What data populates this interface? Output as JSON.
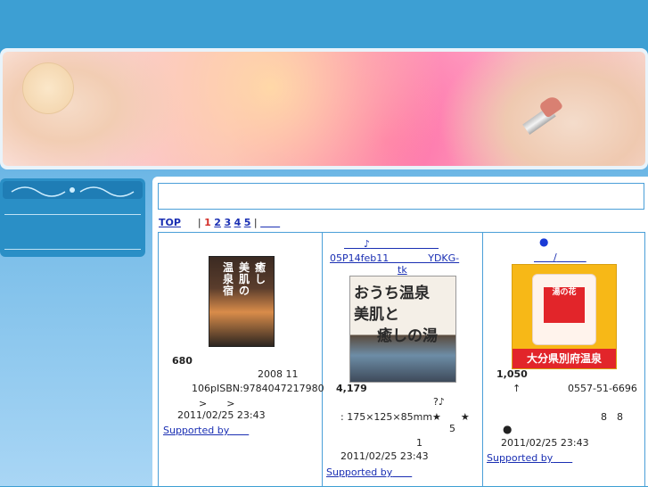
{
  "pager": {
    "top_label": "TOP",
    "sep": "|",
    "current": "1",
    "pages": [
      "2",
      "3",
      "4",
      "5"
    ],
    "end_link": "　　"
  },
  "items": [
    {
      "price": "680",
      "desc1": "2008 11",
      "desc2": "106pISBN:9784047217980",
      "desc3": ">　　>",
      "date": "2011/02/25 23:43",
      "supported": "Supported by"
    },
    {
      "title_line1": "♪",
      "title_line2": "05P14feb11　　　　YDKG-",
      "title_line3": "tk",
      "image_text1": "おうち温泉",
      "image_text2": "美肌と",
      "image_text3": "癒しの湯",
      "price": "4,179",
      "desc1": "?♪",
      "desc2": ": 175×125×85mm★　　★",
      "desc3": "5",
      "desc4": "1",
      "date": "2011/02/25 23:43",
      "supported": "Supported by"
    },
    {
      "title_dot": "●",
      "title_line2": "/",
      "image_banner": "大分県別府温泉",
      "image_bag_text": "湯の花",
      "price": "1,050",
      "desc1": "↑",
      "phone": "0557-51-6696",
      "desc2": "8　8",
      "bullet": "●",
      "date": "2011/02/25 23:43",
      "supported": "Supported by"
    }
  ],
  "book_cover_text": [
    "癒し",
    "美肌の",
    "温泉宿"
  ]
}
